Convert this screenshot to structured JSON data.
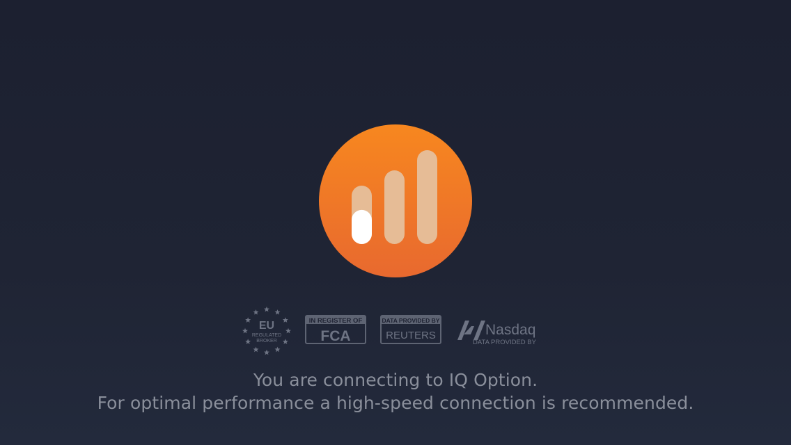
{
  "logo": {
    "icon": "iq-option-logo-icon",
    "color_top": "#f7871f",
    "color_bottom": "#e8692f",
    "bar_color": "#e6bc96",
    "loading_progress": 0.45
  },
  "badges": {
    "eu": {
      "icon": "eu-stars-icon",
      "title": "EU",
      "line1": "REGULATED",
      "line2": "BROKER"
    },
    "fca": {
      "top": "IN REGISTER OF",
      "main": "FCA"
    },
    "reuters": {
      "top": "DATA PROVIDED BY",
      "main": "REUTERS"
    },
    "nasdaq": {
      "icon": "nasdaq-n-icon",
      "name": "Nasdaq",
      "sub": "DATA PROVIDED BY"
    }
  },
  "messages": {
    "line1": "You are connecting to IQ Option.",
    "line2": "For optimal performance a high-speed connection is recommended."
  }
}
